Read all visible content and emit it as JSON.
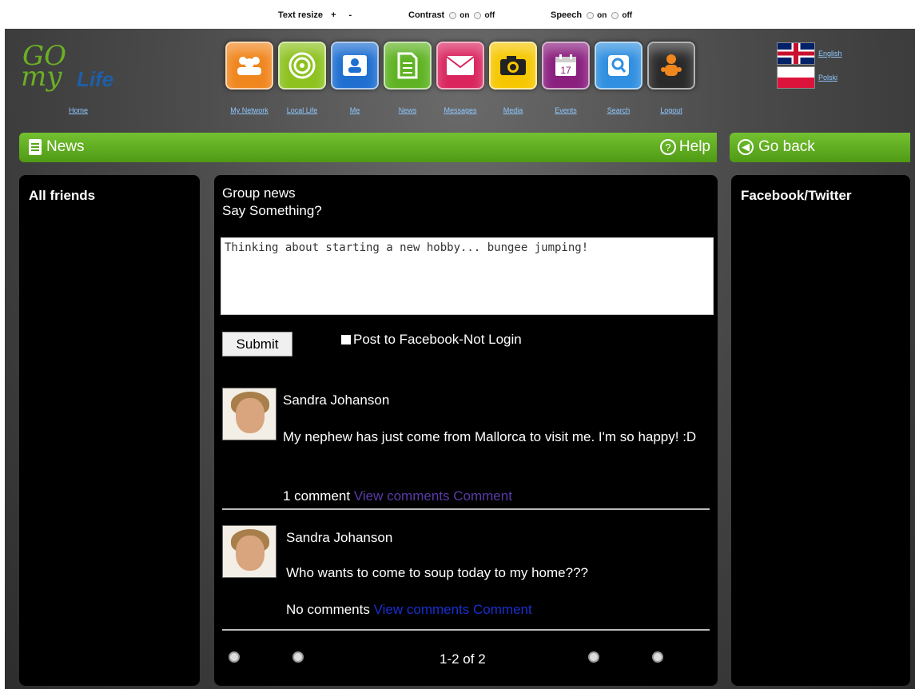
{
  "accessibility": {
    "text_resize_label": "Text resize",
    "text_resize_plus": "+",
    "text_resize_minus": "-",
    "contrast_label": "Contrast",
    "speech_label": "Speech",
    "on_label": "on",
    "off_label": "off"
  },
  "logo": {
    "go": "GO",
    "my": "my",
    "life": "Life"
  },
  "header": {
    "home_label": "Home",
    "nav": [
      {
        "label": "My Network",
        "icon": "network-icon",
        "color": "#f0861e"
      },
      {
        "label": "Local Life",
        "icon": "target-icon",
        "color": "#8dc21f"
      },
      {
        "label": "Me",
        "icon": "person-icon",
        "color": "#1f6fd1"
      },
      {
        "label": "News",
        "icon": "document-icon",
        "color": "#5fb323"
      },
      {
        "label": "Messages",
        "icon": "envelope-icon",
        "color": "#d9245e"
      },
      {
        "label": "Media",
        "icon": "camera-icon",
        "color": "#f6c700"
      },
      {
        "label": "Events",
        "icon": "calendar-icon",
        "color": "#8a1f7e"
      },
      {
        "label": "Search",
        "icon": "magnifier-icon",
        "color": "#2f8fe0"
      },
      {
        "label": "Logout",
        "icon": "logout-figure-icon",
        "color": "#2a2a2a"
      }
    ],
    "languages": [
      {
        "label": "English",
        "icon": "uk-flag-icon"
      },
      {
        "label": "Polski",
        "icon": "poland-flag-icon"
      }
    ]
  },
  "news_bar": {
    "title": "News",
    "help_label": "Help"
  },
  "back_bar": {
    "label": "Go back"
  },
  "left_panel": {
    "title": "All friends"
  },
  "right_panel": {
    "title": "Facebook/Twitter"
  },
  "main": {
    "group_news": "Group news",
    "prompt": "Say Something?",
    "post_value": "Thinking about starting a new hobby... bungee jumping!",
    "submit_label": "Submit",
    "facebook_checkbox_label": "Post to Facebook-Not Login",
    "posts": [
      {
        "author": "Sandra Johanson",
        "text": "My nephew has just come from Mallorca to visit me. I'm so happy! :D",
        "comment_count": "1 comment",
        "view_comments_label": "View comments",
        "comment_label": "Comment"
      },
      {
        "author": "Sandra Johanson",
        "text": "Who wants to come to soup today to my home???",
        "comment_count": "No comments",
        "view_comments_label": "View comments",
        "comment_label": "Comment"
      }
    ],
    "pagination": "1-2 of 2"
  }
}
